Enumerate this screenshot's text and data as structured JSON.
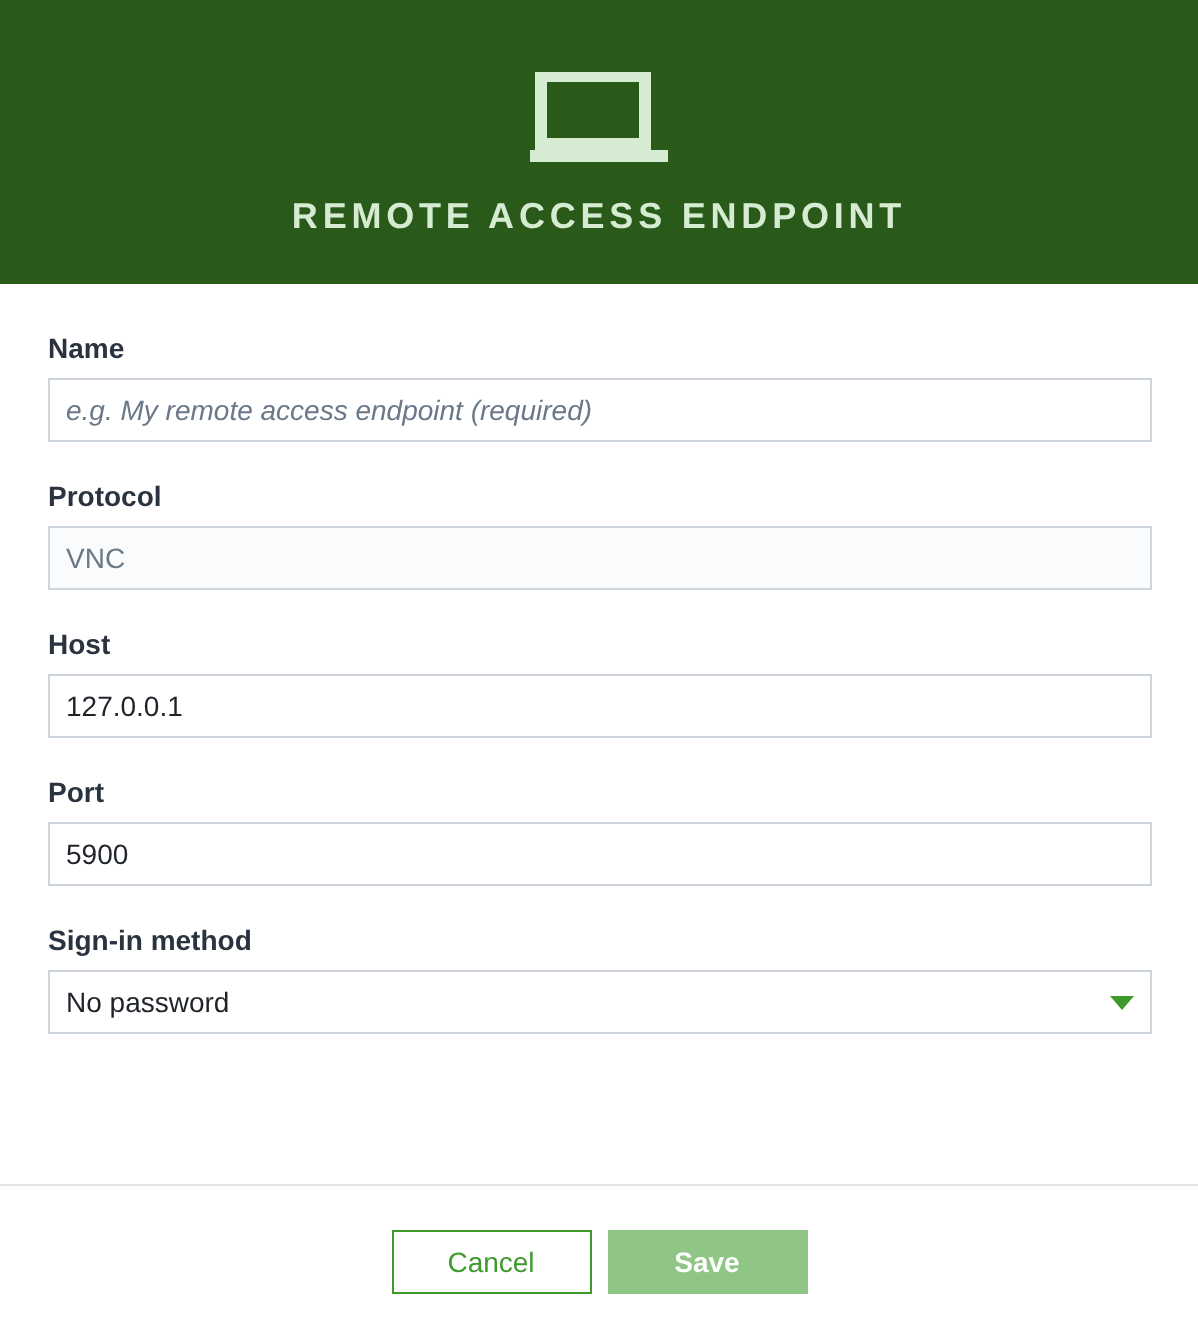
{
  "header": {
    "title": "REMOTE ACCESS ENDPOINT"
  },
  "fields": [
    {
      "label": "Name",
      "kind": "text",
      "placeholder": "e.g. My remote access endpoint (required)",
      "disabled": false
    },
    {
      "label": "Protocol",
      "kind": "text",
      "value": "VNC",
      "disabled": true
    },
    {
      "label": "Host",
      "kind": "text",
      "value": "127.0.0.1",
      "disabled": false
    },
    {
      "label": "Port",
      "kind": "text",
      "value": "5900",
      "disabled": false
    },
    {
      "label": "Sign-in method",
      "kind": "select",
      "value": "No password",
      "disabled": false
    }
  ],
  "buttons": [
    {
      "label": "Cancel",
      "kind": "secondary",
      "disabled": false
    },
    {
      "label": "Save",
      "kind": "primary",
      "disabled": true
    }
  ]
}
